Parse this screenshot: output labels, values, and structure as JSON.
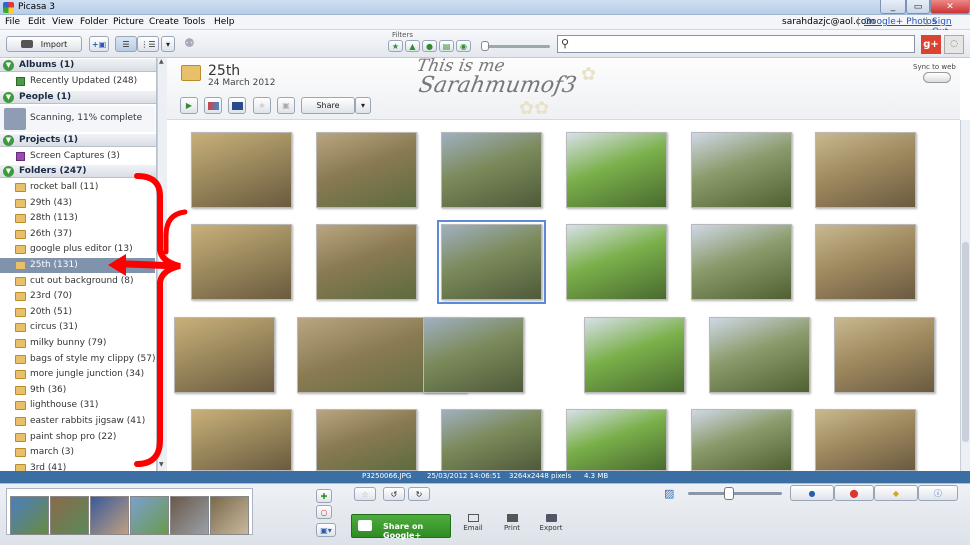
{
  "window": {
    "title": "Picasa 3"
  },
  "menu": [
    "File",
    "Edit",
    "View",
    "Folder",
    "Picture",
    "Create",
    "Tools",
    "Help"
  ],
  "account": {
    "email": "sarahdazjc@aol.com",
    "gplus": "Google+ Photos",
    "signout": "Sign Out"
  },
  "toolbar": {
    "import_label": "Import",
    "filters_label": "Filters",
    "search_placeholder": ""
  },
  "sidebar": {
    "albums": "Albums (1)",
    "recently_updated": "Recently Updated (248)",
    "people": "People (1)",
    "scanning": "Scanning, 11% complete",
    "projects": "Projects (1)",
    "screen_captures": "Screen Captures (3)",
    "folders": "Folders (247)",
    "folder_items": [
      "rocket ball (11)",
      "29th (43)",
      "28th (113)",
      "26th (37)",
      "google plus editor (13)",
      "25th (131)",
      "cut out background (8)",
      "23rd (70)",
      "20th (51)",
      "circus (31)",
      "milky bunny (79)",
      "bags of style my clippy (57)",
      "more jungle junction (34)",
      "9th (36)",
      "lighthouse (31)",
      "easter rabbits jigsaw (41)",
      "paint shop pro (22)",
      "march (3)",
      "3rd (41)"
    ],
    "selected_index": 5
  },
  "album": {
    "title": "25th",
    "date": "24 March 2012",
    "share_label": "Share",
    "sync_label": "Sync to web",
    "watermark_line1": "This is me",
    "watermark_line2": "Sarahmumof3"
  },
  "status": {
    "filename": "P3250066.JPG",
    "datetime": "25/03/2012 14:06:51",
    "dimensions": "3264x2448 pixels",
    "size": "4.3 MB"
  },
  "bottom": {
    "share_gplus": "Share on Google+",
    "email": "Email",
    "print": "Print",
    "export": "Export"
  },
  "colors": {
    "accent": "#3b6fa3",
    "selection": "#7f93ad",
    "gplus_green": "#3c9a2e",
    "annotation_red": "#ff0000"
  }
}
